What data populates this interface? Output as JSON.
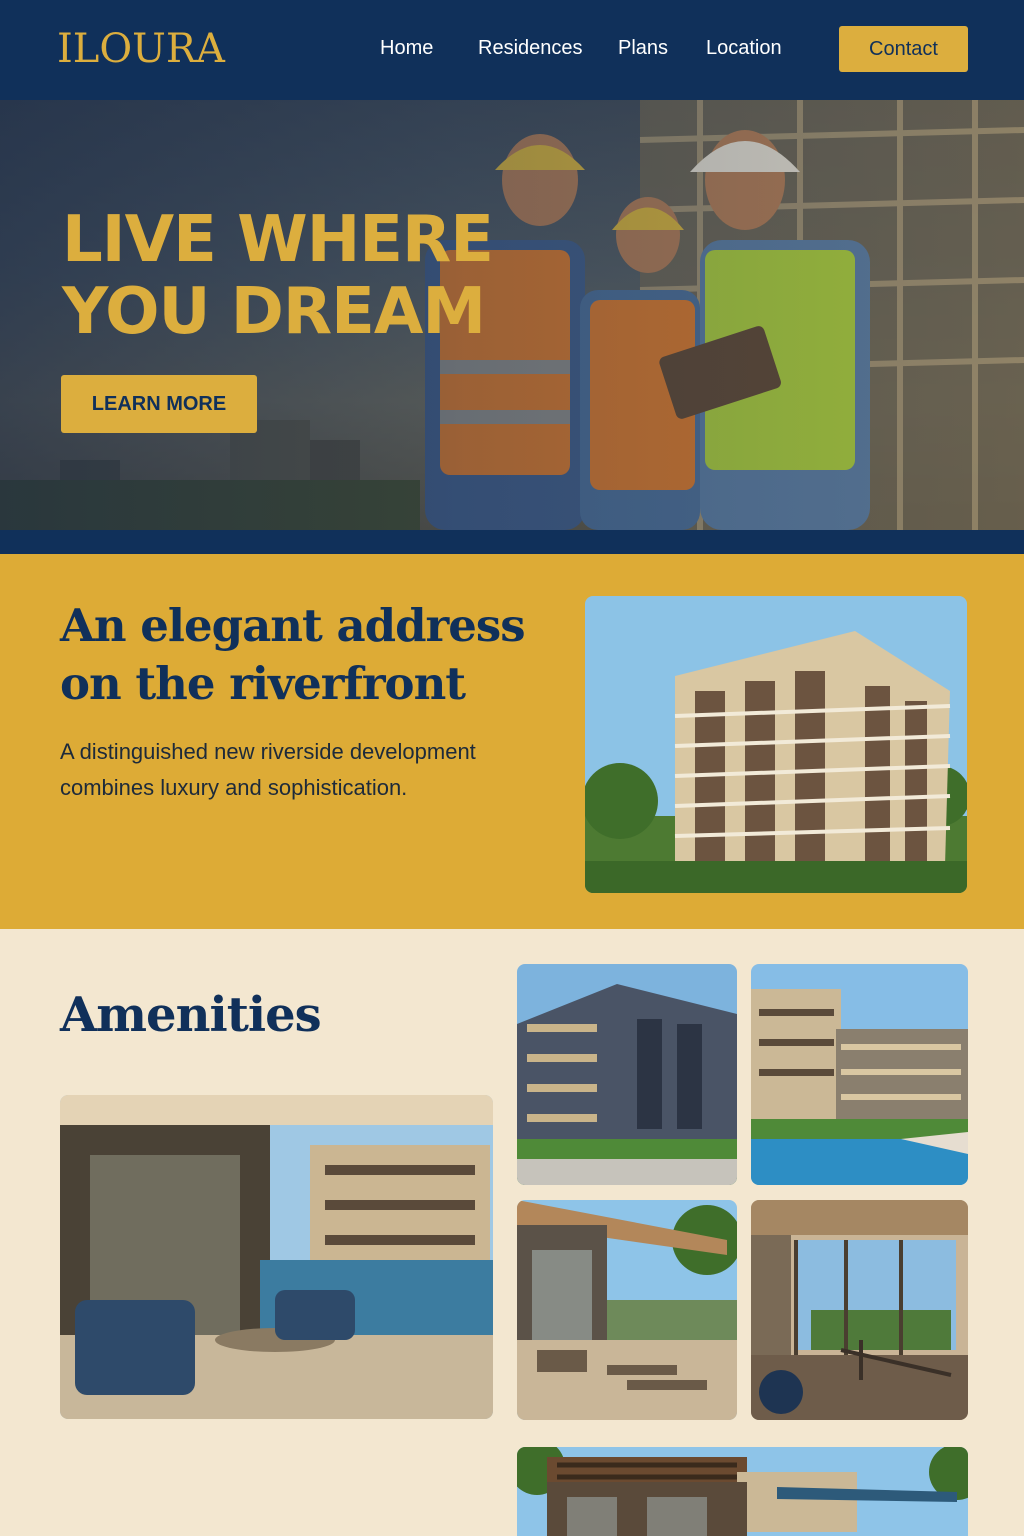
{
  "header": {
    "logo": "ILOURA",
    "nav": [
      {
        "label": "Home"
      },
      {
        "label": "Residences"
      },
      {
        "label": "Plans"
      },
      {
        "label": "Location"
      }
    ],
    "contact_label": "Contact"
  },
  "hero": {
    "title": "LIVE WHERE YOU DREAM",
    "button_label": "LEARN MORE"
  },
  "intro": {
    "title": "An elegant address on the riverfront",
    "text": "A distinguished new riverside development combines luxury and sophistication."
  },
  "amenities": {
    "title": "Amenities"
  },
  "colors": {
    "navy": "#10305a",
    "gold": "#dcae3e",
    "cream": "#f3e7d0"
  }
}
